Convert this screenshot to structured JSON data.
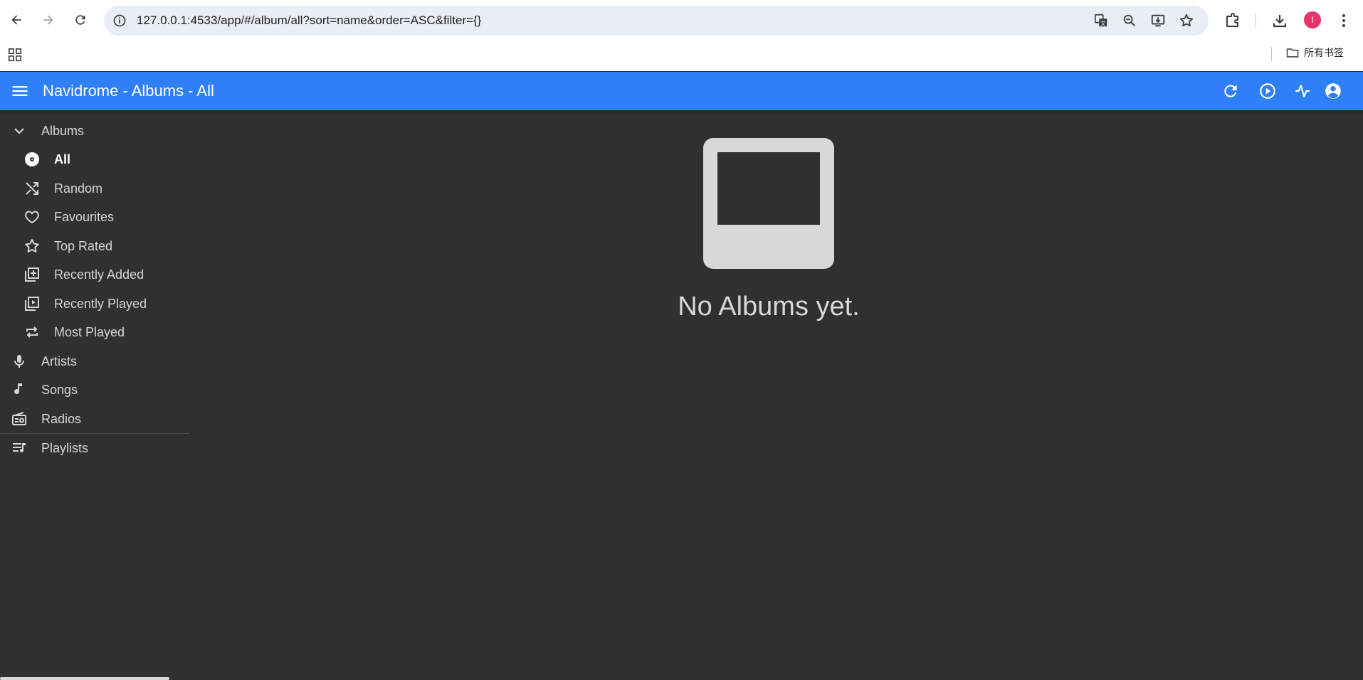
{
  "browser": {
    "url": "127.0.0.1:4533/app/#/album/all?sort=name&order=ASC&filter={}",
    "profile_initial": "I",
    "bookmark_folder": "所有书签"
  },
  "appbar": {
    "title": "Navidrome - Albums - All"
  },
  "sidebar": {
    "albums_label": "Albums",
    "album_items": [
      {
        "label": "All",
        "icon": "album-icon",
        "active": true
      },
      {
        "label": "Random",
        "icon": "shuffle-icon"
      },
      {
        "label": "Favourites",
        "icon": "heart-icon"
      },
      {
        "label": "Top Rated",
        "icon": "star-icon"
      },
      {
        "label": "Recently Added",
        "icon": "library-add-icon"
      },
      {
        "label": "Recently Played",
        "icon": "video-library-icon"
      },
      {
        "label": "Most Played",
        "icon": "repeat-icon"
      }
    ],
    "sections": [
      {
        "label": "Artists",
        "icon": "microphone-icon"
      },
      {
        "label": "Songs",
        "icon": "music-note-icon"
      },
      {
        "label": "Radios",
        "icon": "radio-icon"
      },
      {
        "label": "Playlists",
        "icon": "queue-music-icon"
      }
    ]
  },
  "main": {
    "empty_message": "No Albums yet."
  },
  "colors": {
    "appbar": "#2f7ff7",
    "background": "#303030",
    "profile": "#e8336b"
  }
}
